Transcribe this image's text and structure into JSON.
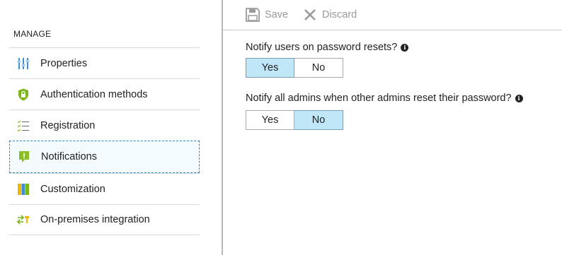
{
  "toolbar": {
    "save_label": "Save",
    "discard_label": "Discard"
  },
  "sidebar": {
    "section_label": "MANAGE",
    "items": [
      {
        "label": "Properties",
        "icon": "properties-icon"
      },
      {
        "label": "Authentication methods",
        "icon": "shield-lock-icon"
      },
      {
        "label": "Registration",
        "icon": "checklist-icon"
      },
      {
        "label": "Notifications",
        "icon": "notification-icon",
        "selected": true
      },
      {
        "label": "Customization",
        "icon": "customization-icon"
      },
      {
        "label": "On-premises integration",
        "icon": "sync-icon"
      }
    ]
  },
  "main": {
    "settings": [
      {
        "question": "Notify users on password resets?",
        "options": [
          "Yes",
          "No"
        ],
        "selected": "Yes"
      },
      {
        "question": "Notify all admins when other admins reset their password?",
        "options": [
          "Yes",
          "No"
        ],
        "selected": "No"
      }
    ]
  },
  "colors": {
    "selected_toggle": "#bfe7f7",
    "selected_nav_border": "#2b88b8",
    "accent_green": "#8cbf26"
  }
}
